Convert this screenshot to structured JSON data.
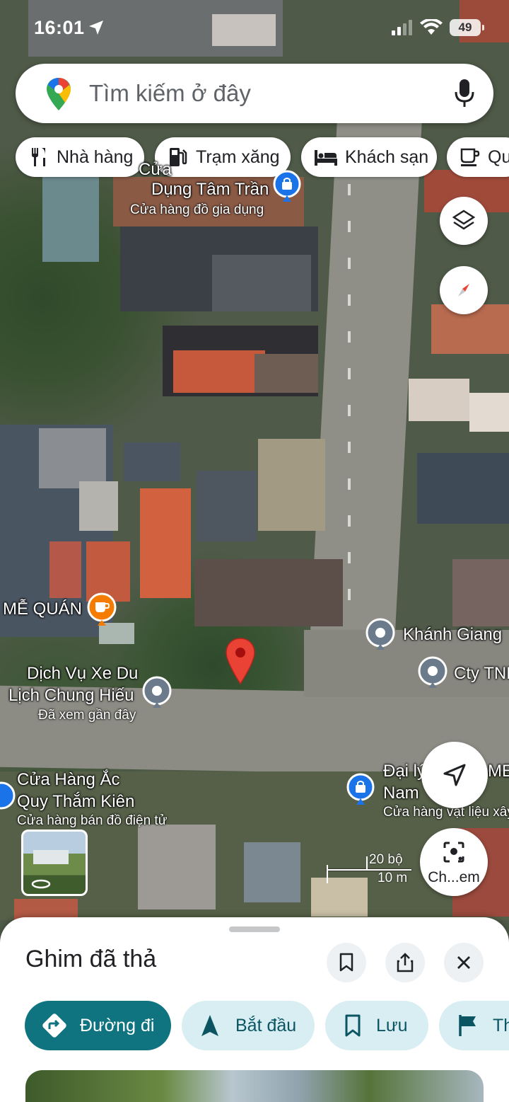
{
  "status_bar": {
    "time": "16:01",
    "battery": "49"
  },
  "search": {
    "placeholder": "Tìm kiếm ở đây",
    "icons": [
      "google-maps-pin-icon",
      "mic-icon"
    ]
  },
  "chips": [
    {
      "label": "Nhà hàng",
      "icon": "restaurant-icon"
    },
    {
      "label": "Trạm xăng",
      "icon": "gas-station-icon"
    },
    {
      "label": "Khách sạn",
      "icon": "hotel-bed-icon"
    },
    {
      "label": "Qu",
      "icon": "cafe-cup-icon"
    }
  ],
  "map_labels": {
    "top_shop_partial": "Cửa",
    "top_shop_name": "Dụng Tâm Trần",
    "top_shop_type": "Cửa hàng đồ gia dụng",
    "cafe_name": "MỄ QUÁN",
    "khanh_giang": "Khánh Giang",
    "cty": "Cty TNH",
    "dich_vu_line1": "Dịch Vụ Xe Du",
    "dich_vu_line2": "Lịch Chung Hiếu",
    "dich_vu_sub": "Đã xem gần đây",
    "dai_ly_line1": "Đại lý",
    "dai_ly_partial": "MEC",
    "dai_ly_line2": "Nam",
    "dai_ly_type": "Cửa hàng vật liệu xây",
    "cua_hang_line1": "Cửa Hàng Ắc",
    "cua_hang_line2": "Quy Thắm Kiên",
    "cua_hang_type": "Cửa hàng bán đồ điện tử"
  },
  "scale": {
    "imperial": "20 bộ",
    "metric": "10 m"
  },
  "lens_label": "Ch...em",
  "sheet": {
    "title": "Ghim đã thả",
    "actions": [
      {
        "label": "Đường đi",
        "icon": "directions-icon"
      },
      {
        "label": "Bắt đầu",
        "icon": "navigation-arrow-icon"
      },
      {
        "label": "Lưu",
        "icon": "bookmark-icon"
      },
      {
        "label": "Th",
        "icon": "flag-icon"
      }
    ]
  },
  "colors": {
    "accent": "#0f7480",
    "chip_bg": "#d8eef2",
    "pin_red": "#ea4335",
    "poi_blue": "#1a73e8",
    "poi_orange": "#f57c00",
    "poi_gray": "#6b7b8c"
  }
}
